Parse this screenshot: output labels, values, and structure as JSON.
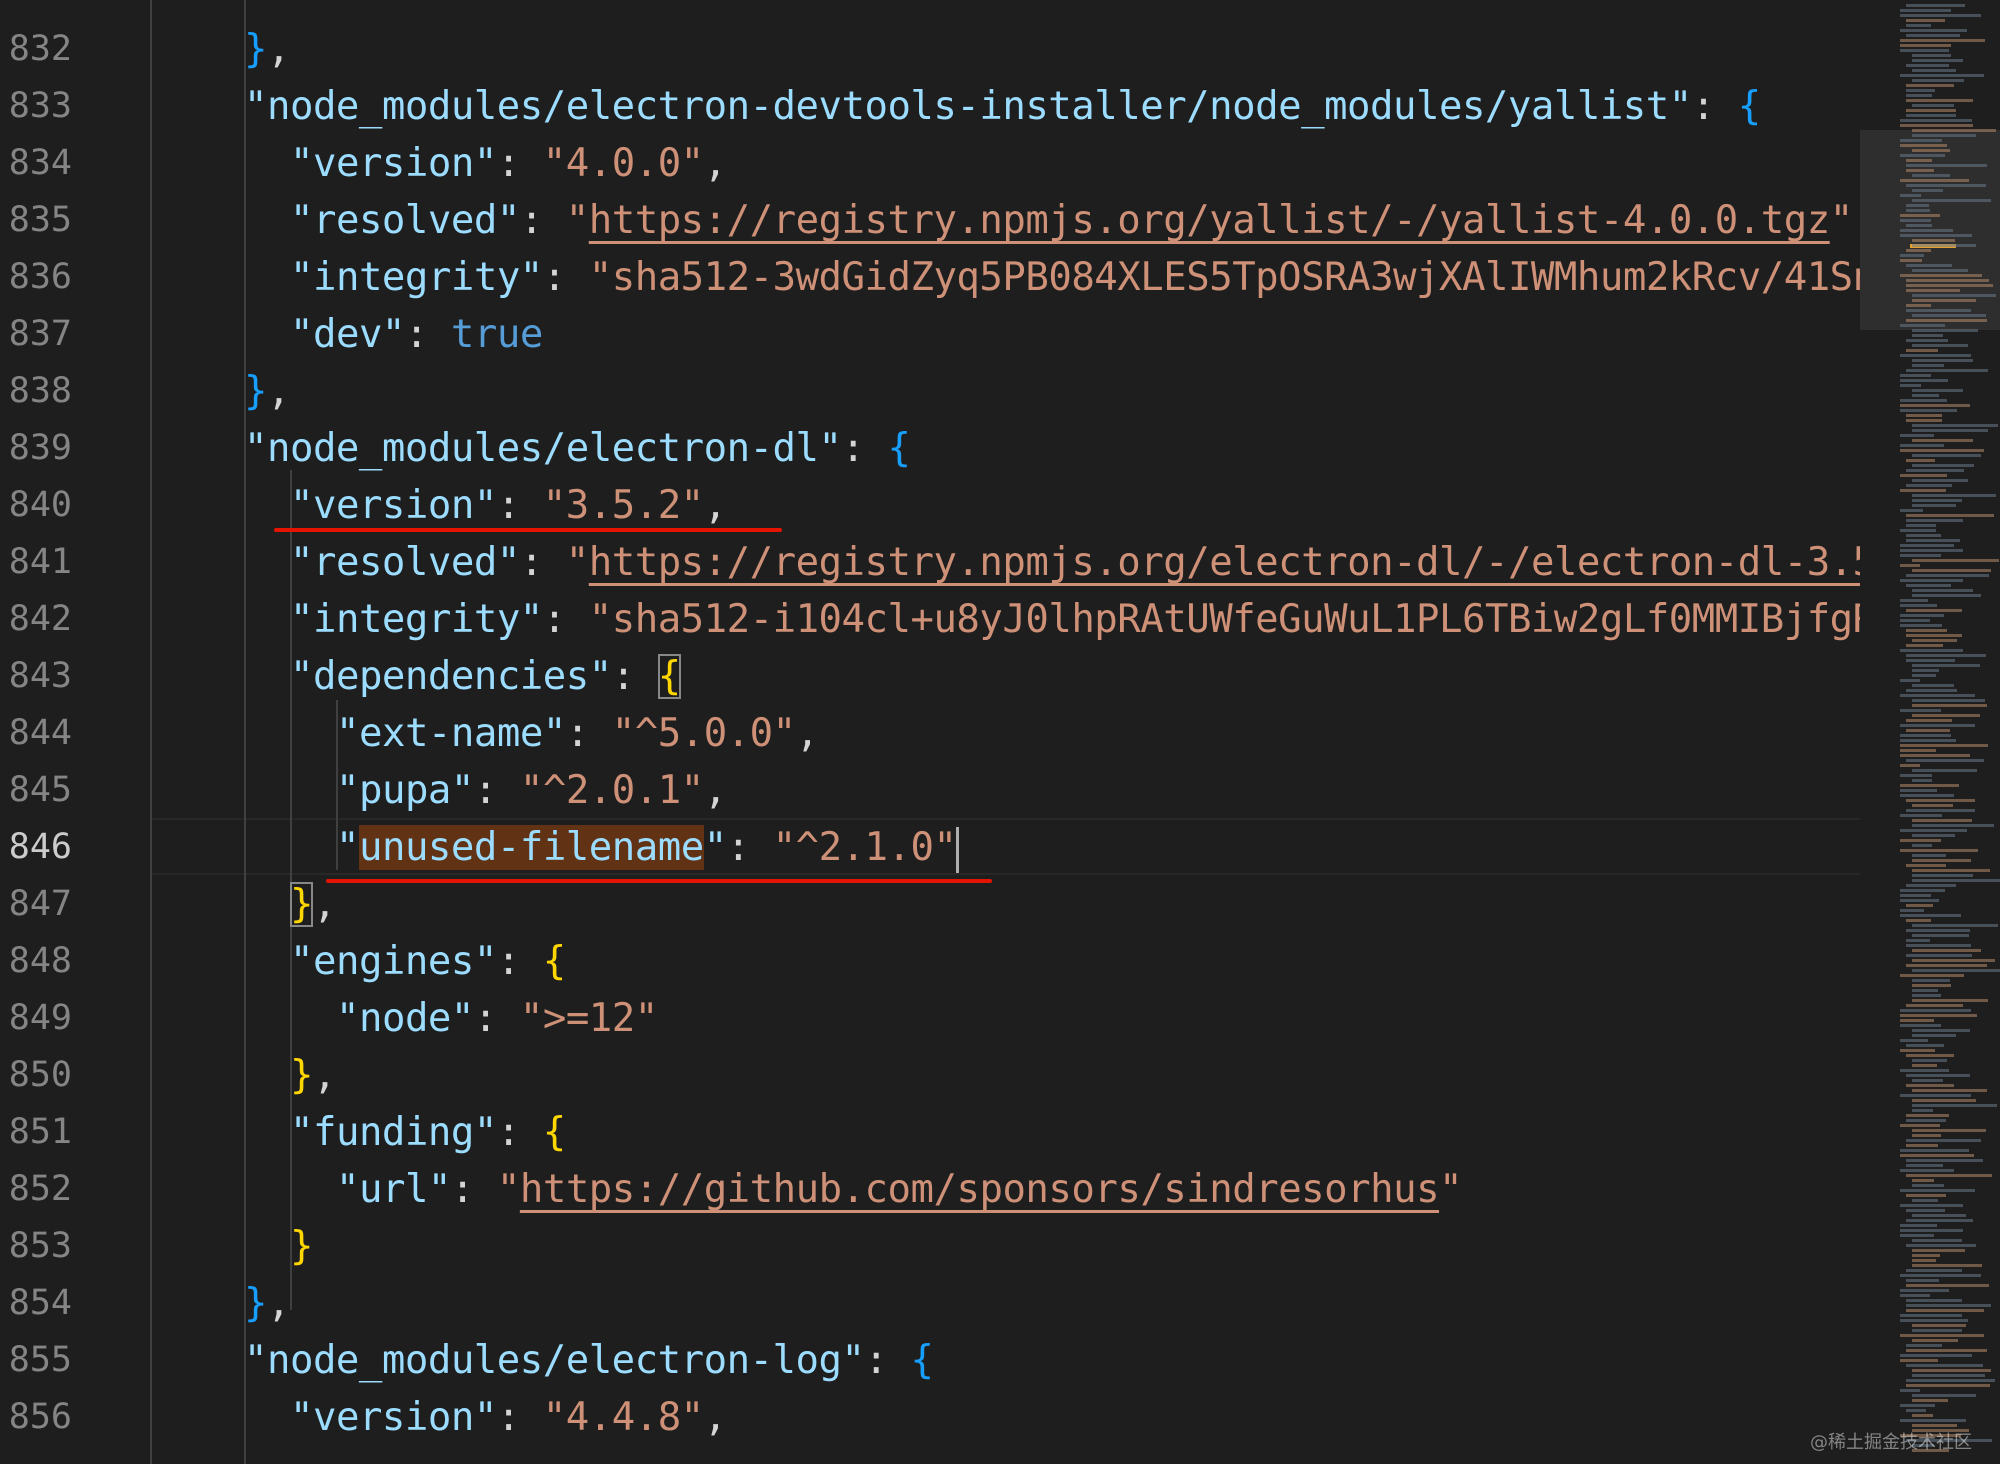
{
  "editor": {
    "language": "json",
    "active_line_number": "846",
    "lines": [
      {
        "num": "832",
        "segments": [
          {
            "text": "}",
            "cls": "b3"
          },
          {
            "text": ",",
            "cls": "p"
          }
        ]
      },
      {
        "num": "833",
        "segments": [
          {
            "text": "\"node_modules/electron-devtools-installer/node_modules/yallist\"",
            "cls": "key"
          },
          {
            "text": ": ",
            "cls": "p"
          },
          {
            "text": "{",
            "cls": "b3"
          }
        ]
      },
      {
        "num": "834",
        "segments": [
          {
            "text": "\"version\"",
            "cls": "key"
          },
          {
            "text": ": ",
            "cls": "p"
          },
          {
            "text": "\"4.0.0\"",
            "cls": "str"
          },
          {
            "text": ",",
            "cls": "p"
          }
        ]
      },
      {
        "num": "835",
        "segments": [
          {
            "text": "\"resolved\"",
            "cls": "key"
          },
          {
            "text": ": ",
            "cls": "p"
          },
          {
            "text": "\"",
            "cls": "str"
          },
          {
            "text": "https://registry.npmjs.org/yallist/-/yallist-4.0.0.tgz",
            "cls": "url"
          },
          {
            "text": "\"",
            "cls": "str"
          },
          {
            "text": ",",
            "cls": "p"
          }
        ]
      },
      {
        "num": "836",
        "segments": [
          {
            "text": "\"integrity\"",
            "cls": "key"
          },
          {
            "text": ": ",
            "cls": "p"
          },
          {
            "text": "\"sha512-3wdGidZyq5PB084XLES5TpOSRA3wjXAlIWMhum2kRcv/41Sn",
            "cls": "str"
          }
        ]
      },
      {
        "num": "837",
        "segments": [
          {
            "text": "\"dev\"",
            "cls": "key"
          },
          {
            "text": ": ",
            "cls": "p"
          },
          {
            "text": "true",
            "cls": "bool"
          }
        ]
      },
      {
        "num": "838",
        "segments": [
          {
            "text": "}",
            "cls": "b3"
          },
          {
            "text": ",",
            "cls": "p"
          }
        ]
      },
      {
        "num": "839",
        "segments": [
          {
            "text": "\"node_modules/electron-dl\"",
            "cls": "key"
          },
          {
            "text": ": ",
            "cls": "p"
          },
          {
            "text": "{",
            "cls": "b3"
          }
        ]
      },
      {
        "num": "840",
        "segments": [
          {
            "text": "\"version\"",
            "cls": "key"
          },
          {
            "text": ": ",
            "cls": "p"
          },
          {
            "text": "\"3.5.2\"",
            "cls": "str"
          },
          {
            "text": ",",
            "cls": "p"
          }
        ]
      },
      {
        "num": "841",
        "segments": [
          {
            "text": "\"resolved\"",
            "cls": "key"
          },
          {
            "text": ": ",
            "cls": "p"
          },
          {
            "text": "\"",
            "cls": "str"
          },
          {
            "text": "https://registry.npmjs.org/electron-dl/-/electron-dl-3.5",
            "cls": "url"
          }
        ]
      },
      {
        "num": "842",
        "segments": [
          {
            "text": "\"integrity\"",
            "cls": "key"
          },
          {
            "text": ": ",
            "cls": "p"
          },
          {
            "text": "\"sha512-i104cl+u8yJ0lhpRAtUWfeGuWuL1PL6TBiw2gLf0MMIBjfgR",
            "cls": "str"
          }
        ]
      },
      {
        "num": "843",
        "segments": [
          {
            "text": "\"dependencies\"",
            "cls": "key"
          },
          {
            "text": ": ",
            "cls": "p"
          },
          {
            "text": "{",
            "cls": "b1 bracket-box"
          }
        ]
      },
      {
        "num": "844",
        "segments": [
          {
            "text": "\"ext-name\"",
            "cls": "key"
          },
          {
            "text": ": ",
            "cls": "p"
          },
          {
            "text": "\"^5.0.0\"",
            "cls": "str"
          },
          {
            "text": ",",
            "cls": "p"
          }
        ]
      },
      {
        "num": "845",
        "segments": [
          {
            "text": "\"pupa\"",
            "cls": "key"
          },
          {
            "text": ": ",
            "cls": "p"
          },
          {
            "text": "\"^2.0.1\"",
            "cls": "str"
          },
          {
            "text": ",",
            "cls": "p"
          }
        ]
      },
      {
        "num": "846",
        "segments": [
          {
            "text": "\"",
            "cls": "key"
          },
          {
            "text": "unused-filename",
            "cls": "key hl"
          },
          {
            "text": "\"",
            "cls": "key"
          },
          {
            "text": ": ",
            "cls": "p"
          },
          {
            "text": "\"^2.1.0\"",
            "cls": "str"
          }
        ],
        "cursor": true
      },
      {
        "num": "847",
        "segments": [
          {
            "text": "}",
            "cls": "b1 bracket-box"
          },
          {
            "text": ",",
            "cls": "p"
          }
        ]
      },
      {
        "num": "848",
        "segments": [
          {
            "text": "\"engines\"",
            "cls": "key"
          },
          {
            "text": ": ",
            "cls": "p"
          },
          {
            "text": "{",
            "cls": "b1"
          }
        ]
      },
      {
        "num": "849",
        "segments": [
          {
            "text": "\"node\"",
            "cls": "key"
          },
          {
            "text": ": ",
            "cls": "p"
          },
          {
            "text": "\">=12\"",
            "cls": "str"
          }
        ]
      },
      {
        "num": "850",
        "segments": [
          {
            "text": "}",
            "cls": "b1"
          },
          {
            "text": ",",
            "cls": "p"
          }
        ]
      },
      {
        "num": "851",
        "segments": [
          {
            "text": "\"funding\"",
            "cls": "key"
          },
          {
            "text": ": ",
            "cls": "p"
          },
          {
            "text": "{",
            "cls": "b1"
          }
        ]
      },
      {
        "num": "852",
        "segments": [
          {
            "text": "\"url\"",
            "cls": "key"
          },
          {
            "text": ": ",
            "cls": "p"
          },
          {
            "text": "\"",
            "cls": "str"
          },
          {
            "text": "https://github.com/sponsors/sindresorhus",
            "cls": "url"
          },
          {
            "text": "\"",
            "cls": "str"
          }
        ]
      },
      {
        "num": "853",
        "segments": [
          {
            "text": "}",
            "cls": "b1"
          }
        ]
      },
      {
        "num": "854",
        "segments": [
          {
            "text": "}",
            "cls": "b3"
          },
          {
            "text": ",",
            "cls": "p"
          }
        ]
      },
      {
        "num": "855",
        "segments": [
          {
            "text": "\"node_modules/electron-log\"",
            "cls": "key"
          },
          {
            "text": ": ",
            "cls": "p"
          },
          {
            "text": "{",
            "cls": "b3"
          }
        ]
      },
      {
        "num": "856",
        "segments": [
          {
            "text": "\"version\"",
            "cls": "key"
          },
          {
            "text": ": ",
            "cls": "p"
          },
          {
            "text": "\"4.4.8\"",
            "cls": "str"
          },
          {
            "text": ",",
            "cls": "p"
          }
        ]
      }
    ]
  },
  "watermark": "@稀土掘金技术社区"
}
